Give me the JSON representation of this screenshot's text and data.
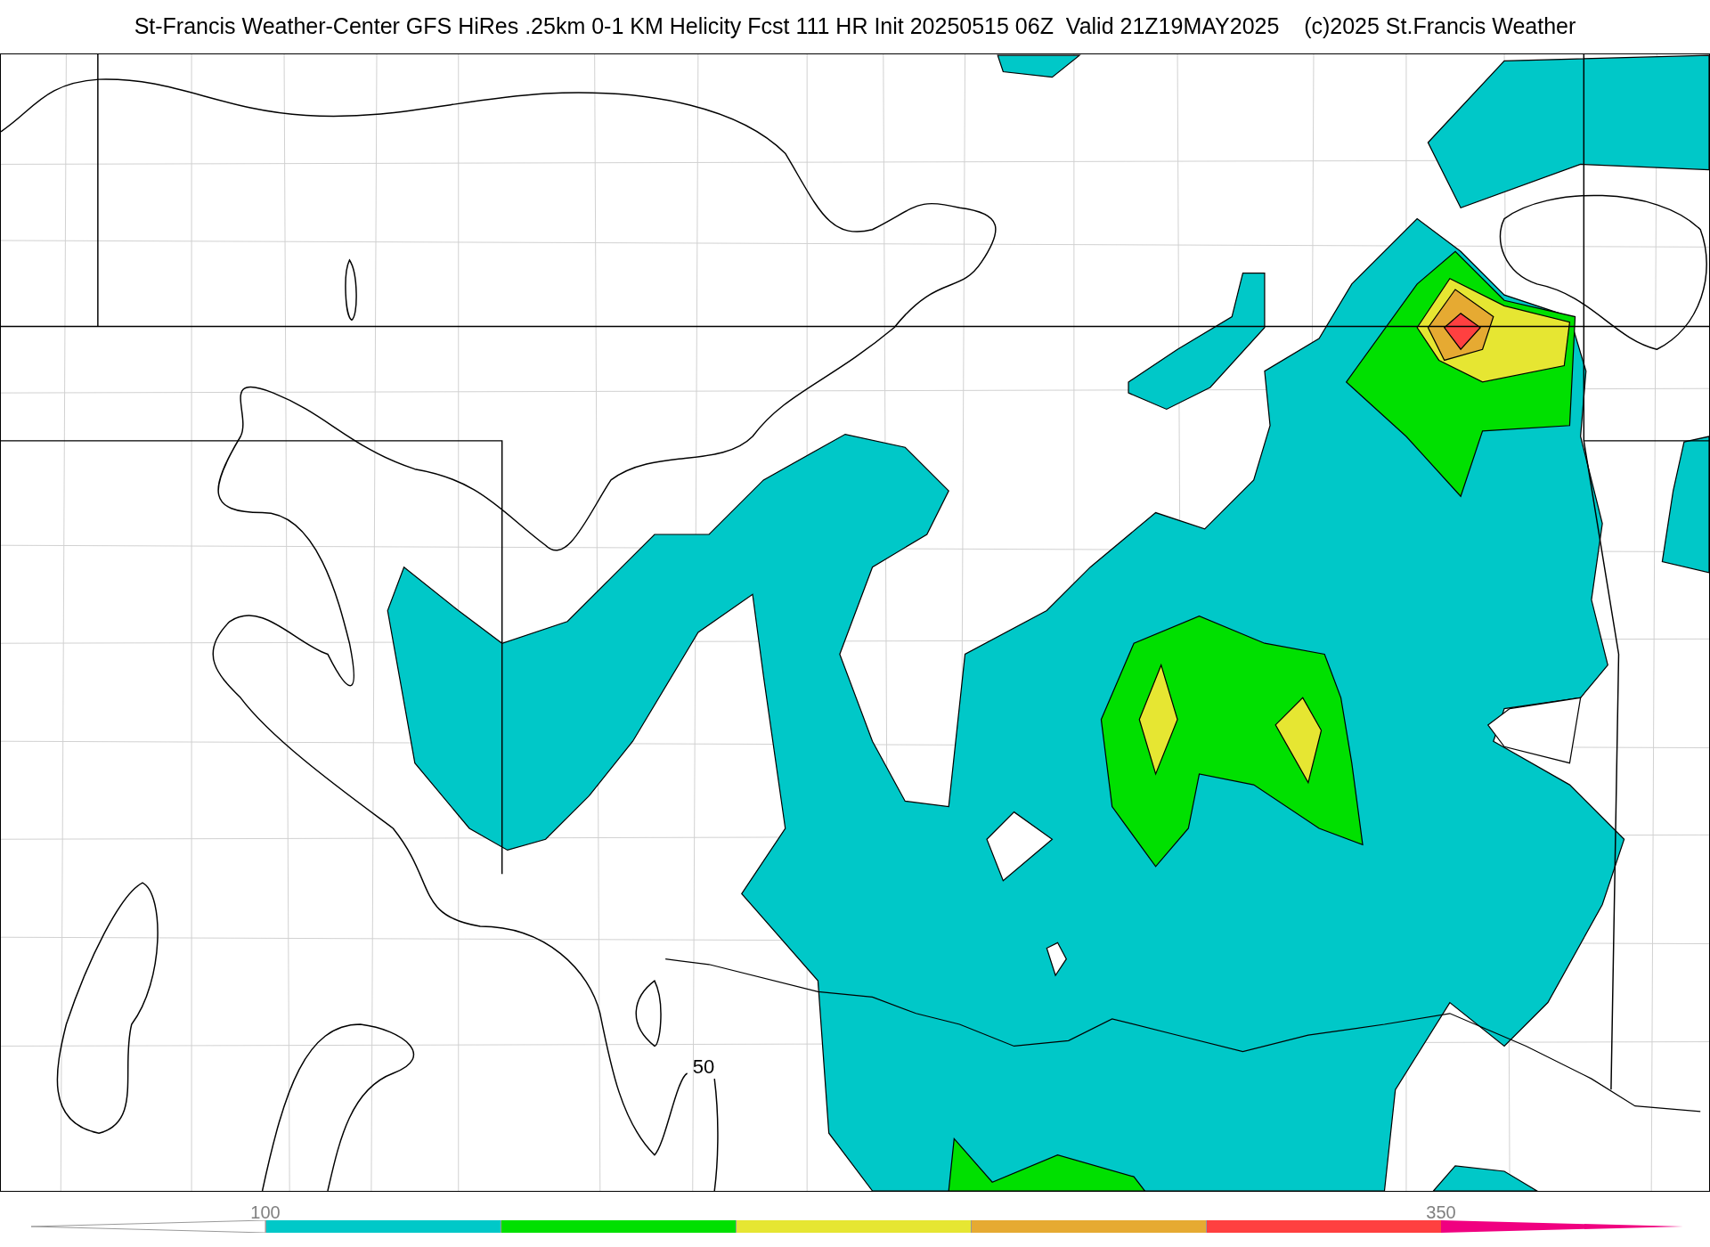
{
  "title": "St-Francis Weather-Center GFS HiRes .25km 0-1 KM Helicity Fcst 111 HR Init 20250515 06Z  Valid 21Z19MAY2025    (c)2025 St.Francis Weather",
  "map": {
    "contour_label": "50"
  },
  "colorbar": {
    "segments": [
      {
        "kind": "arrow-left"
      },
      {
        "kind": "box",
        "color": "#00c8c8",
        "label": "100"
      },
      {
        "kind": "box",
        "color": "#00e000"
      },
      {
        "kind": "box",
        "color": "#e6e632"
      },
      {
        "kind": "box",
        "color": "#e6aa32"
      },
      {
        "kind": "box",
        "color": "#ff4040"
      },
      {
        "kind": "arrow-right",
        "color": "#f00080",
        "label": "350"
      }
    ]
  }
}
